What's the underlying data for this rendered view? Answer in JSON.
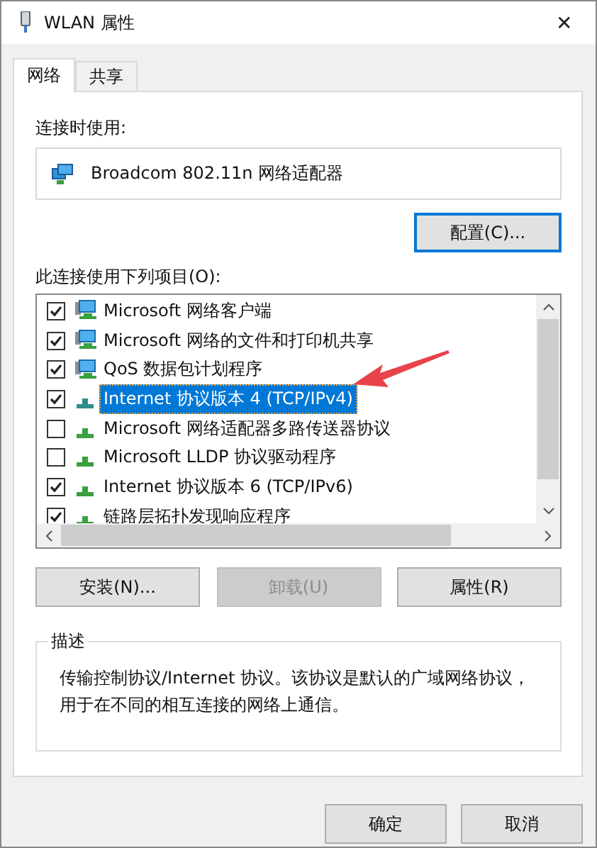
{
  "window": {
    "title": "WLAN 属性",
    "close": "✕"
  },
  "tabs": [
    {
      "label": "网络",
      "selected": true
    },
    {
      "label": "共享",
      "selected": false
    }
  ],
  "connect_using": {
    "label": "连接时使用:",
    "adapter": "Broadcom 802.11n 网络适配器",
    "configure_button": "配置(C)..."
  },
  "items_label": "此连接使用下列项目(O):",
  "items": [
    {
      "label": "Microsoft 网络客户端",
      "kind": "service",
      "checked": true,
      "selected": false
    },
    {
      "label": "Microsoft 网络的文件和打印机共享",
      "kind": "service",
      "checked": true,
      "selected": false
    },
    {
      "label": "QoS 数据包计划程序",
      "kind": "service",
      "checked": true,
      "selected": false
    },
    {
      "label": "Internet 协议版本 4 (TCP/IPv4)",
      "kind": "protocol",
      "checked": true,
      "selected": true
    },
    {
      "label": "Microsoft 网络适配器多路传送器协议",
      "kind": "protocol",
      "checked": false,
      "selected": false
    },
    {
      "label": "Microsoft LLDP 协议驱动程序",
      "kind": "protocol",
      "checked": false,
      "selected": false
    },
    {
      "label": "Internet 协议版本 6 (TCP/IPv6)",
      "kind": "protocol",
      "checked": true,
      "selected": false
    },
    {
      "label": "链路层拓扑发现响应程序",
      "kind": "protocol",
      "checked": true,
      "selected": false
    }
  ],
  "action_buttons": [
    {
      "label": "安装(N)...",
      "disabled": false
    },
    {
      "label": "卸载(U)",
      "disabled": true
    },
    {
      "label": "属性(R)",
      "disabled": false
    }
  ],
  "description": {
    "legend": "描述",
    "text": "传输控制协议/Internet 协议。该协议是默认的广域网络协议，用于在不同的相互连接的网络上通信。"
  },
  "dialog_buttons": [
    "确定",
    "取消"
  ]
}
